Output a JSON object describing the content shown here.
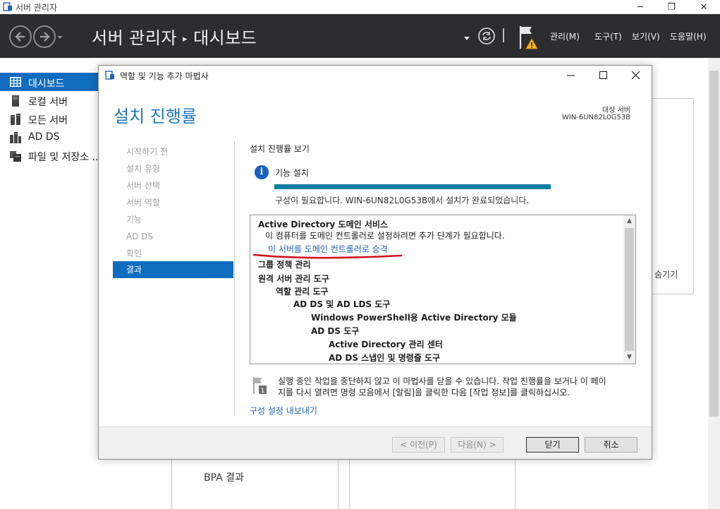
{
  "window": {
    "title": "서버 관리자",
    "controls": [
      "─",
      "❐",
      "✕"
    ]
  },
  "header": {
    "title": "서버 관리자",
    "page": "대시보드",
    "menus": [
      "관리(M)",
      "도구(T)",
      "보기(V)",
      "도움말(H)"
    ]
  },
  "sidebar": {
    "items": [
      {
        "label": "대시보드",
        "icon": "dashboard-icon",
        "active": true
      },
      {
        "label": "로컬 서버",
        "icon": "server-icon"
      },
      {
        "label": "모든 서버",
        "icon": "servers-icon"
      },
      {
        "label": "AD DS",
        "icon": "ad-ds-icon"
      },
      {
        "label": "파일 및 저장소 ...",
        "icon": "file-storage-icon"
      }
    ]
  },
  "background": {
    "hide_label": "숨기기",
    "bpa_label": "BPA 결과"
  },
  "dialog": {
    "title": "역할 및 기능 추가 마법사",
    "heading": "설치 진행률",
    "dest_label": "대상 서버",
    "dest_server": "WIN-6UN82L0G53B",
    "steps": [
      "시작하기 전",
      "설치 유형",
      "서버 선택",
      "서버 역할",
      "기능",
      "AD DS",
      "확인",
      "결과"
    ],
    "active_step": 7,
    "content_label": "설치 진행률 보기",
    "feature_install": "기능 설치",
    "progress": 1.0,
    "status": "구성이 필요합니다. WIN-6UN82L0G53B에서 설치가 완료되었습니다.",
    "results": {
      "ad_title": "Active Directory 도메인 서비스",
      "ad_desc": "이 컴퓨터를 도메인 컨트롤러로 설정하려면 추가 단계가 필요합니다.",
      "promote_link": "이 서버를 도메인 컨트롤러로 승격",
      "gpm": "그룹 정책 관리",
      "rsat": "원격 서버 관리 도구",
      "role_tools": "역할 관리 도구",
      "adds_lds": "AD DS 및 AD LDS 도구",
      "ps_module": "Windows PowerShell용 Active Directory 모듈",
      "adds_tools": "AD DS 도구",
      "admin_center": "Active Directory 관리 센터",
      "snapins": "AD DS 스냅인 및 명령줄 도구"
    },
    "note_line1": "실행 중인 작업을 중단하지 않고 이 마법사를 닫을 수 있습니다. 작업 진행률을 보거나 이 페이",
    "note_line2": "지를 다시 열려면 명령 모음에서 [알림]을 클릭한 다음 [작업 정보]를 클릭하십시오.",
    "export_link": "구성 설정 내보내기",
    "buttons": {
      "prev": "< 이전(P)",
      "next": "다음(N) >",
      "close": "닫기",
      "cancel": "취소"
    }
  },
  "colors": {
    "header_bg": "#2d2d30",
    "accent": "#0f6cbf",
    "progress": "#0f7ea3",
    "link": "#1e63b8",
    "annotation": "#d0101e"
  }
}
